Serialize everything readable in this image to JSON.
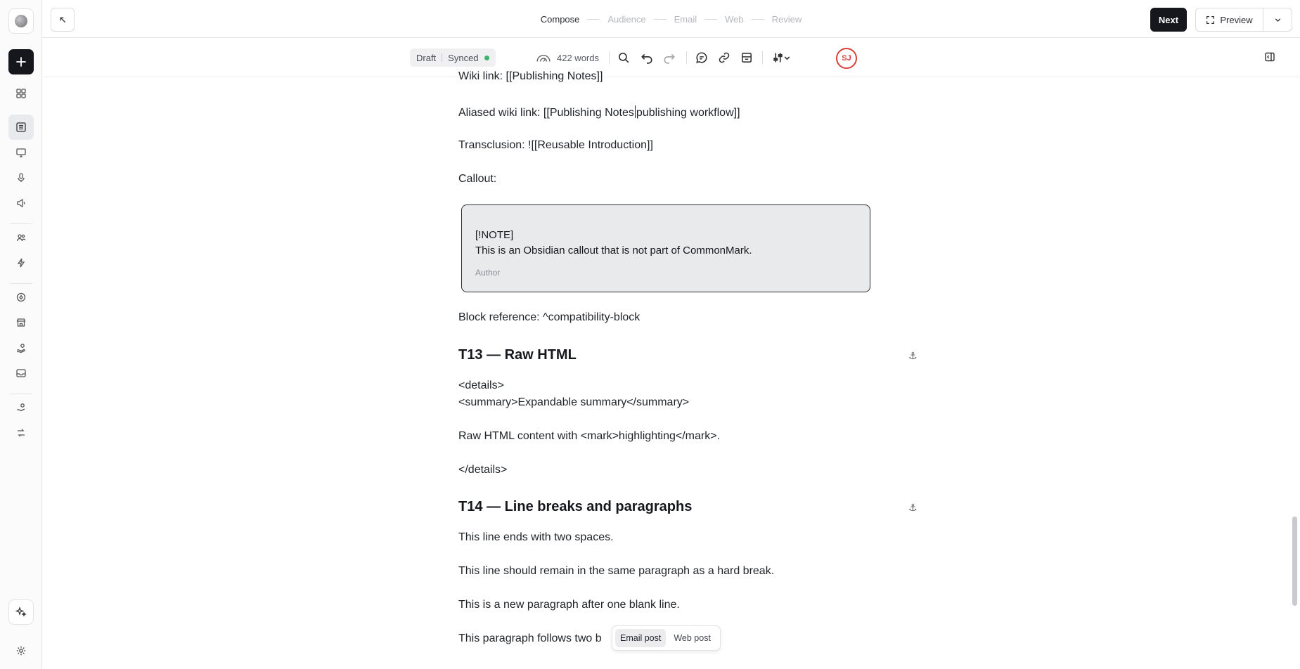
{
  "topbar": {
    "steps": [
      {
        "label": "Compose",
        "current": true
      },
      {
        "label": "Audience",
        "current": false
      },
      {
        "label": "Email",
        "current": false
      },
      {
        "label": "Web",
        "current": false
      },
      {
        "label": "Review",
        "current": false
      }
    ],
    "next_label": "Next",
    "preview_label": "Preview"
  },
  "toolbar": {
    "status_draft": "Draft",
    "status_synced": "Synced",
    "word_count": "422 words",
    "avatar_initials": "SJ"
  },
  "content": {
    "wiki_link": "Wiki link: [[Publishing Notes]]",
    "aliased_a": "Aliased wiki link: [[Publishing Notes",
    "aliased_b": "publishing workflow]]",
    "transclusion": "Transclusion: ![[Reusable Introduction]]",
    "callout_label": "Callout:",
    "callout": {
      "line1": "[!NOTE]",
      "line2": "This is an Obsidian callout that is not part of CommonMark.",
      "author": "Author"
    },
    "block_ref": "Block reference: ^compatibility-block",
    "h_t13": "T13 — Raw HTML",
    "details_open": "<details>",
    "summary": "<summary>Expandable summary</summary>",
    "raw_html": "Raw HTML content with <mark>highlighting</mark>.",
    "details_close": "</details>",
    "h_t14": "T14 — Line breaks and paragraphs",
    "p1": "This line ends with two spaces.",
    "p2": "This line should remain in the same paragraph as a hard break.",
    "p3": "This is a new paragraph after one blank line.",
    "p4": "This paragraph follows two b",
    "anchor_glyph": "⚓"
  },
  "post_toggle": {
    "email": "Email post",
    "web": "Web post"
  }
}
